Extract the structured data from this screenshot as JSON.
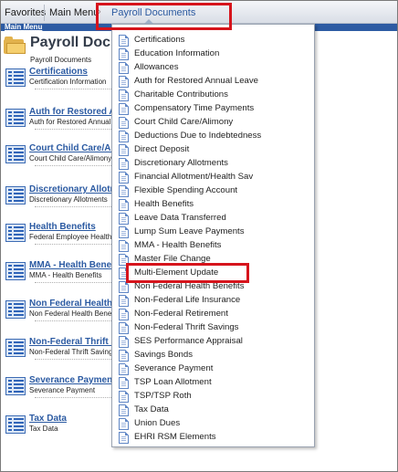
{
  "topbar": {
    "favorites": "Favorites",
    "main_menu": "Main Menu",
    "separator": "›",
    "current": "Payroll Documents"
  },
  "breadcrumb_strip": {
    "label": "Main Menu"
  },
  "page": {
    "title": "Payroll Documents",
    "crumb": "Payroll Documents"
  },
  "list": [
    {
      "title": "Certifications",
      "desc": "Certification Information"
    },
    {
      "title": "Auth for Restored Annual Leave",
      "desc": "Auth for Restored Annual Leave"
    },
    {
      "title": "Court Child Care/Alimony",
      "desc": "Court Child Care/Alimony"
    },
    {
      "title": "Discretionary Allotments",
      "desc": "Discretionary Allotments"
    },
    {
      "title": "Health Benefits",
      "desc": "Federal Employee Health Benefits"
    },
    {
      "title": "MMA - Health Benefits",
      "desc": "MMA - Health Benefits"
    },
    {
      "title": "Non Federal Health Benefits",
      "desc": "Non Federal Health Benefits"
    },
    {
      "title": "Non-Federal Thrift Savings",
      "desc": "Non-Federal Thrift Savings"
    },
    {
      "title": "Severance Payment",
      "desc": "Severance Payment"
    },
    {
      "title": "Tax Data",
      "desc": "Tax Data"
    }
  ],
  "menu": [
    "Certifications",
    "Education Information",
    "Allowances",
    "Auth for Restored Annual Leave",
    "Charitable Contributions",
    "Compensatory Time Payments",
    "Court Child Care/Alimony",
    "Deductions Due to Indebtedness",
    "Direct Deposit",
    "Discretionary Allotments",
    "Financial Allotment/Health Sav",
    "Flexible Spending Account",
    "Health Benefits",
    "Leave Data Transferred",
    "Lump Sum Leave Payments",
    "MMA - Health Benefits",
    "Master File Change",
    "Multi-Element Update",
    "Non Federal Health Benefits",
    "Non-Federal Life Insurance",
    "Non-Federal Retirement",
    "Non-Federal Thrift Savings",
    "SES Performance Appraisal",
    "Savings Bonds",
    "Severance Payment",
    "TSP Loan Allotment",
    "TSP/TSP Roth",
    "Tax Data",
    "Union Dues",
    "EHRI RSM Elements"
  ],
  "colors": {
    "highlight_box": "#d6141c",
    "link_blue": "#2b5aa2",
    "nav_strip": "#2d5ba3"
  },
  "icons": {
    "list": "list-document-icon",
    "menu": "document-icon",
    "page": "folder-icon"
  }
}
